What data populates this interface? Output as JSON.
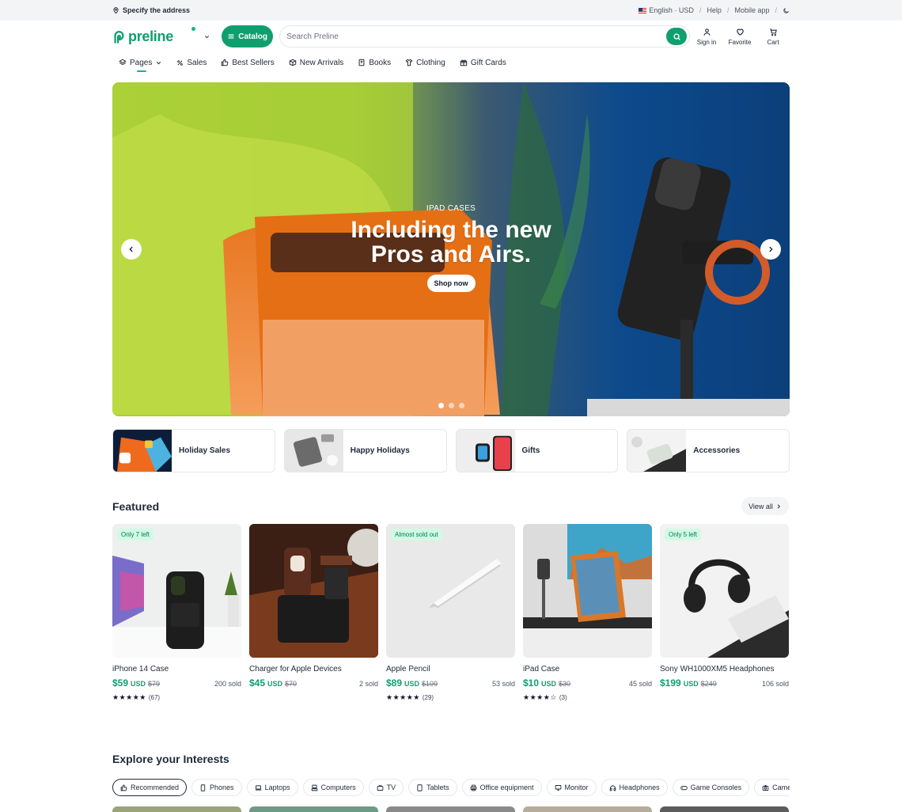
{
  "topbar": {
    "address": "Specify the address",
    "language": "English · USD",
    "help": "Help",
    "mobile_app": "Mobile app"
  },
  "header": {
    "logo": "preline",
    "catalog": "Catalog",
    "search_placeholder": "Search Preline",
    "sign_in": "Sign in",
    "favorite": "Favorite",
    "cart": "Cart"
  },
  "nav": {
    "items": [
      "Pages",
      "Sales",
      "Best Sellers",
      "New Arrivals",
      "Books",
      "Clothing",
      "Gift Cards"
    ]
  },
  "hero": {
    "eyebrow": "IPAD CASES",
    "title_line1": "Including the new",
    "title_line2": "Pros and Airs.",
    "cta": "Shop now",
    "slides": 3,
    "active_slide": 1
  },
  "categories": [
    {
      "label": "Holiday Sales"
    },
    {
      "label": "Happy Holidays"
    },
    {
      "label": "Gifts"
    },
    {
      "label": "Accessories"
    }
  ],
  "featured": {
    "title": "Featured",
    "view_all": "View all",
    "products": [
      {
        "badge": "Only 7 left",
        "name": "iPhone 14 Case",
        "price": "$59",
        "currency": "USD",
        "old": "$79",
        "sold": "200 sold",
        "rating": 5,
        "stars": "★★★★★",
        "reviews": "(67)"
      },
      {
        "badge": "",
        "name": "Charger for Apple Devices",
        "price": "$45",
        "currency": "USD",
        "old": "$70",
        "sold": "2 sold",
        "rating": null,
        "stars": "",
        "reviews": ""
      },
      {
        "badge": "Almost sold out",
        "name": "Apple Pencil",
        "price": "$89",
        "currency": "USD",
        "old": "$109",
        "sold": "53 sold",
        "rating": 5,
        "stars": "★★★★★",
        "reviews": "(29)"
      },
      {
        "badge": "",
        "name": "iPad Case",
        "price": "$10",
        "currency": "USD",
        "old": "$30",
        "sold": "45 sold",
        "rating": 4,
        "stars": "★★★★☆",
        "reviews": "(3)"
      },
      {
        "badge": "Only 5 left",
        "name": "Sony WH1000XM5 Headphones",
        "price": "$199",
        "currency": "USD",
        "old": "$249",
        "sold": "106 sold",
        "rating": null,
        "stars": "",
        "reviews": ""
      }
    ]
  },
  "explore": {
    "title": "Explore your Interests",
    "chips": [
      "Recommended",
      "Phones",
      "Laptops",
      "Computers",
      "TV",
      "Tablets",
      "Office equipment",
      "Monitor",
      "Headphones",
      "Game Consoles",
      "Cameras"
    ]
  },
  "colors": {
    "brand": "#0f9f6e",
    "badge_bg": "#d1fae5",
    "badge_text": "#047857"
  }
}
